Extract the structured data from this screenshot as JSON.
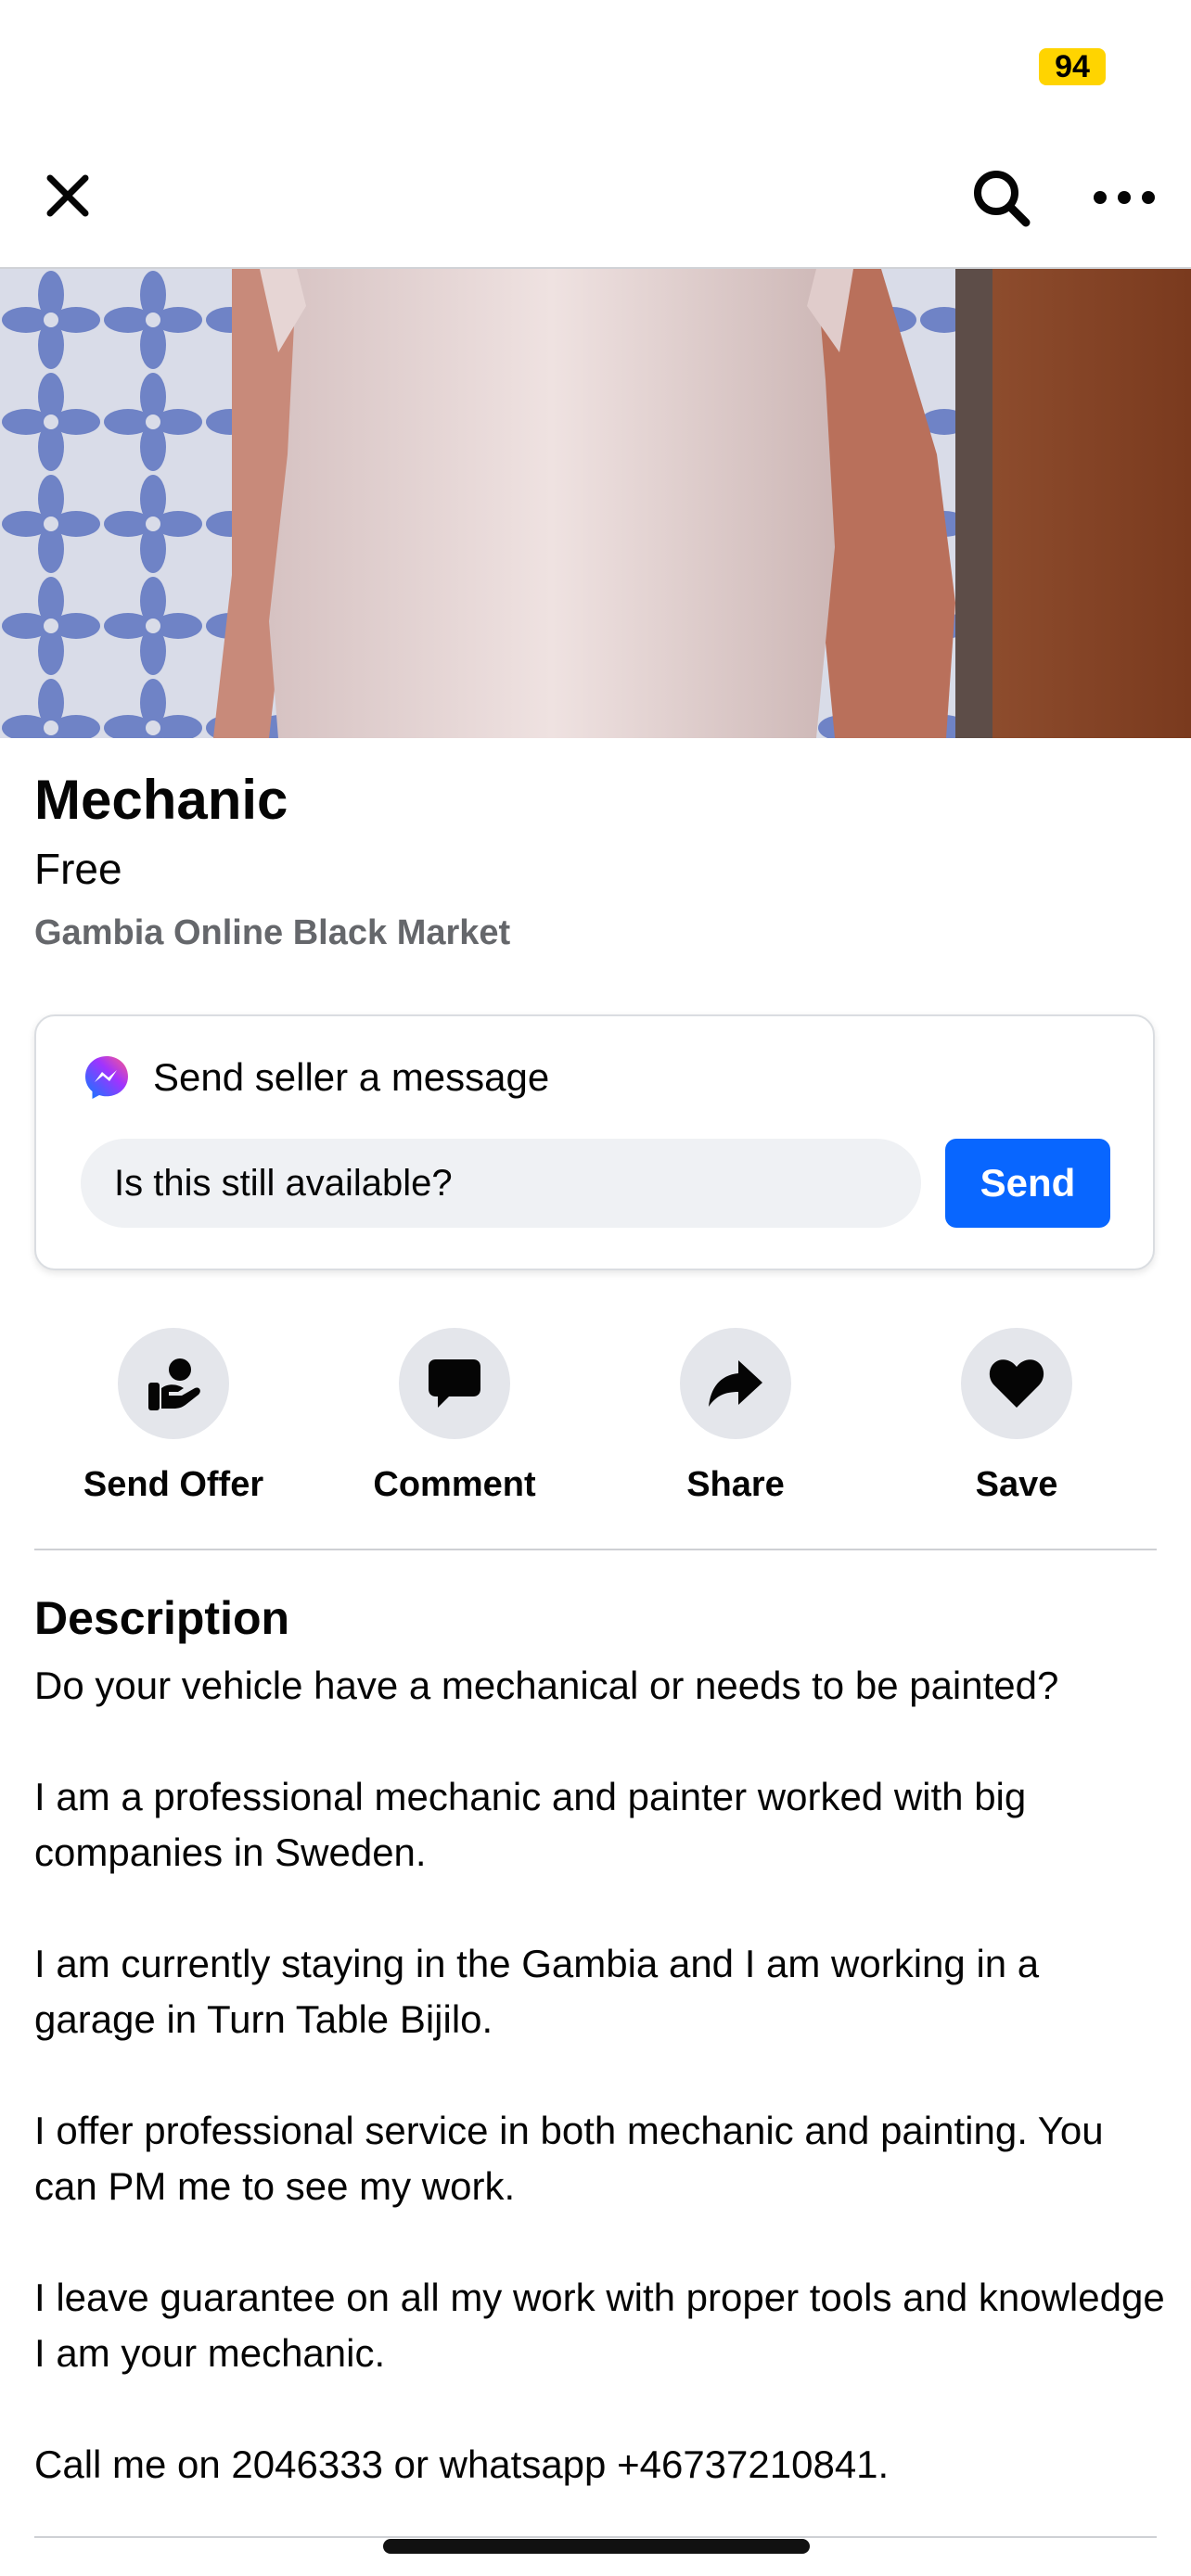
{
  "status": {
    "badge": "94"
  },
  "nav": {
    "close_icon": "close-icon",
    "search_icon": "search-icon",
    "more_icon": "more-icon"
  },
  "listing": {
    "title": "Mechanic",
    "price": "Free",
    "group": "Gambia Online Black Market"
  },
  "message": {
    "header": "Send seller a message",
    "input_value": "Is this still available?",
    "send_label": "Send"
  },
  "actions": [
    {
      "label": "Send Offer",
      "icon": "send-offer-icon"
    },
    {
      "label": "Comment",
      "icon": "comment-icon"
    },
    {
      "label": "Share",
      "icon": "share-icon"
    },
    {
      "label": "Save",
      "icon": "heart-icon"
    }
  ],
  "description": {
    "title": "Description",
    "paragraphs": [
      "Do your vehicle have a mechanical or needs to be painted?",
      "I am a professional mechanic and painter worked with big companies in Sweden.",
      "I am currently staying in the Gambia and I am working in a garage in Turn Table Bijilo.",
      "I offer professional service in both mechanic and painting. You can PM me to see my work.",
      "I leave guarantee on all my work with proper tools and knowledge I am your mechanic.",
      "Call me on 2046333 or whatsapp +46737210841."
    ]
  },
  "colors": {
    "accent": "#0866ff",
    "muted": "#65676b",
    "badge": "#ffd400"
  }
}
